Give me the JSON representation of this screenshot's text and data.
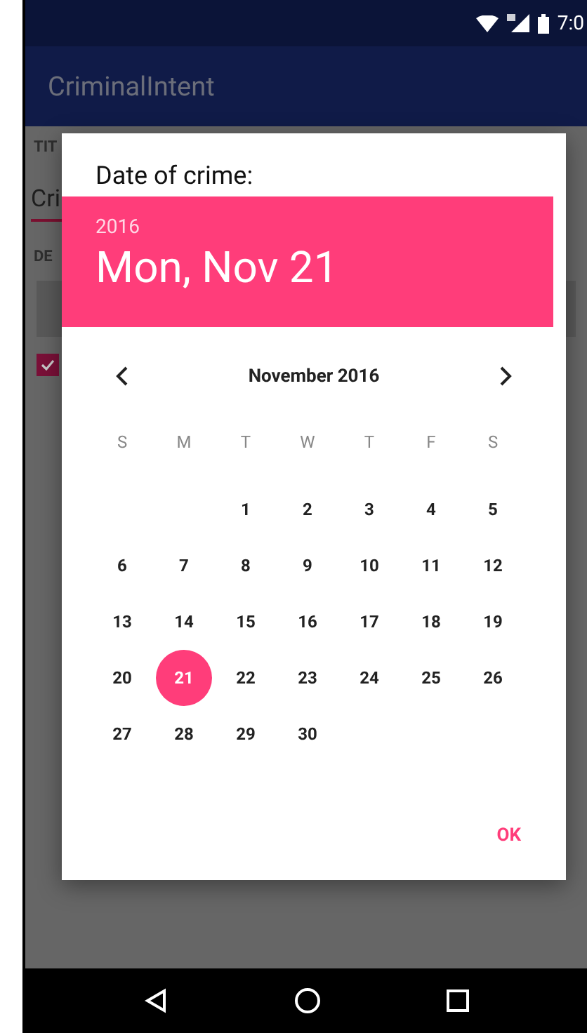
{
  "status_bar": {
    "time": "7:0"
  },
  "app_bar": {
    "title": "CriminalIntent"
  },
  "background_form": {
    "title_label": "TIT",
    "title_value": "Cri",
    "details_label": "DE",
    "solved_checked": true
  },
  "dialog": {
    "title": "Date of crime:",
    "header_year": "2016",
    "header_date": "Mon, Nov 21",
    "month_label": "November 2016",
    "weekdays": [
      "S",
      "M",
      "T",
      "W",
      "T",
      "F",
      "S"
    ],
    "weeks": [
      [
        {
          "label": "1",
          "selected": false
        },
        {
          "label": "2",
          "selected": false
        },
        {
          "label": "3",
          "selected": false
        },
        {
          "label": "4",
          "selected": false
        },
        {
          "label": "5",
          "selected": false
        }
      ],
      [
        {
          "label": "6",
          "selected": false
        },
        {
          "label": "7",
          "selected": false
        },
        {
          "label": "8",
          "selected": false
        },
        {
          "label": "9",
          "selected": false
        },
        {
          "label": "10",
          "selected": false
        },
        {
          "label": "11",
          "selected": false
        },
        {
          "label": "12",
          "selected": false
        }
      ],
      [
        {
          "label": "13",
          "selected": false
        },
        {
          "label": "14",
          "selected": false
        },
        {
          "label": "15",
          "selected": false
        },
        {
          "label": "16",
          "selected": false
        },
        {
          "label": "17",
          "selected": false
        },
        {
          "label": "18",
          "selected": false
        },
        {
          "label": "19",
          "selected": false
        }
      ],
      [
        {
          "label": "20",
          "selected": false
        },
        {
          "label": "21",
          "selected": true
        },
        {
          "label": "22",
          "selected": false
        },
        {
          "label": "23",
          "selected": false
        },
        {
          "label": "24",
          "selected": false
        },
        {
          "label": "25",
          "selected": false
        },
        {
          "label": "26",
          "selected": false
        }
      ],
      [
        {
          "label": "27",
          "selected": false
        },
        {
          "label": "28",
          "selected": false
        },
        {
          "label": "29",
          "selected": false
        },
        {
          "label": "30",
          "selected": false
        }
      ]
    ],
    "ok_button": "OK"
  }
}
